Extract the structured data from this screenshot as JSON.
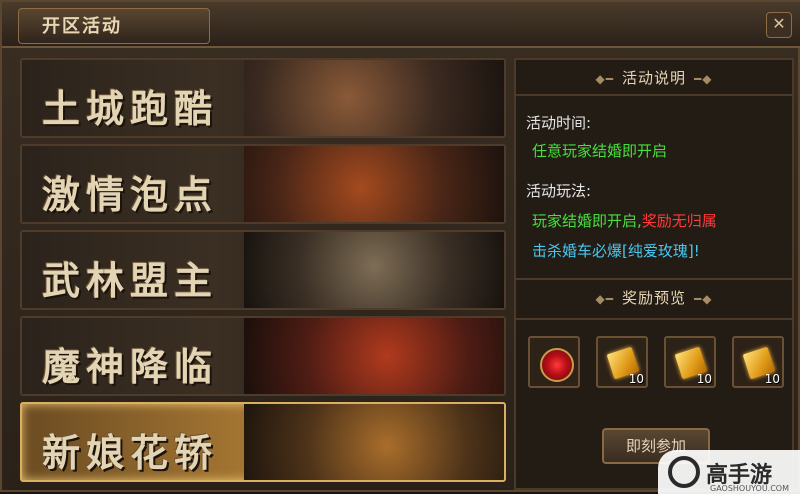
{
  "window": {
    "title": "开区活动",
    "close_icon": "close-icon"
  },
  "menu": {
    "items": [
      {
        "label": "土城跑酷"
      },
      {
        "label": "激情泡点"
      },
      {
        "label": "武林盟主"
      },
      {
        "label": "魔神降临"
      },
      {
        "label": "新娘花轿",
        "active": true
      }
    ]
  },
  "info": {
    "heading": "活动说明",
    "time_label": "活动时间:",
    "time_value": "任意玩家结婚即开启",
    "play_label": "活动玩法:",
    "play_line1_a": "玩家结婚即开启,",
    "play_line1_b": "奖励无归属",
    "play_line2": "击杀婚车必爆[纯爱玫瑰]!"
  },
  "rewards": {
    "heading": "奖励预览",
    "items": [
      {
        "icon": "rose-icon",
        "qty": ""
      },
      {
        "icon": "ticket-icon",
        "qty": "10"
      },
      {
        "icon": "ticket-icon",
        "qty": "10"
      },
      {
        "icon": "ticket-icon",
        "qty": "10"
      }
    ]
  },
  "actions": {
    "join_label": "即刻参加"
  },
  "watermark": {
    "text": "高手游",
    "url": "GAOSHOUYOU.COM"
  },
  "colors": {
    "green": "#46e03d",
    "red": "#ff3b3b",
    "blue": "#49c7f0",
    "gold": "#d9b062"
  }
}
